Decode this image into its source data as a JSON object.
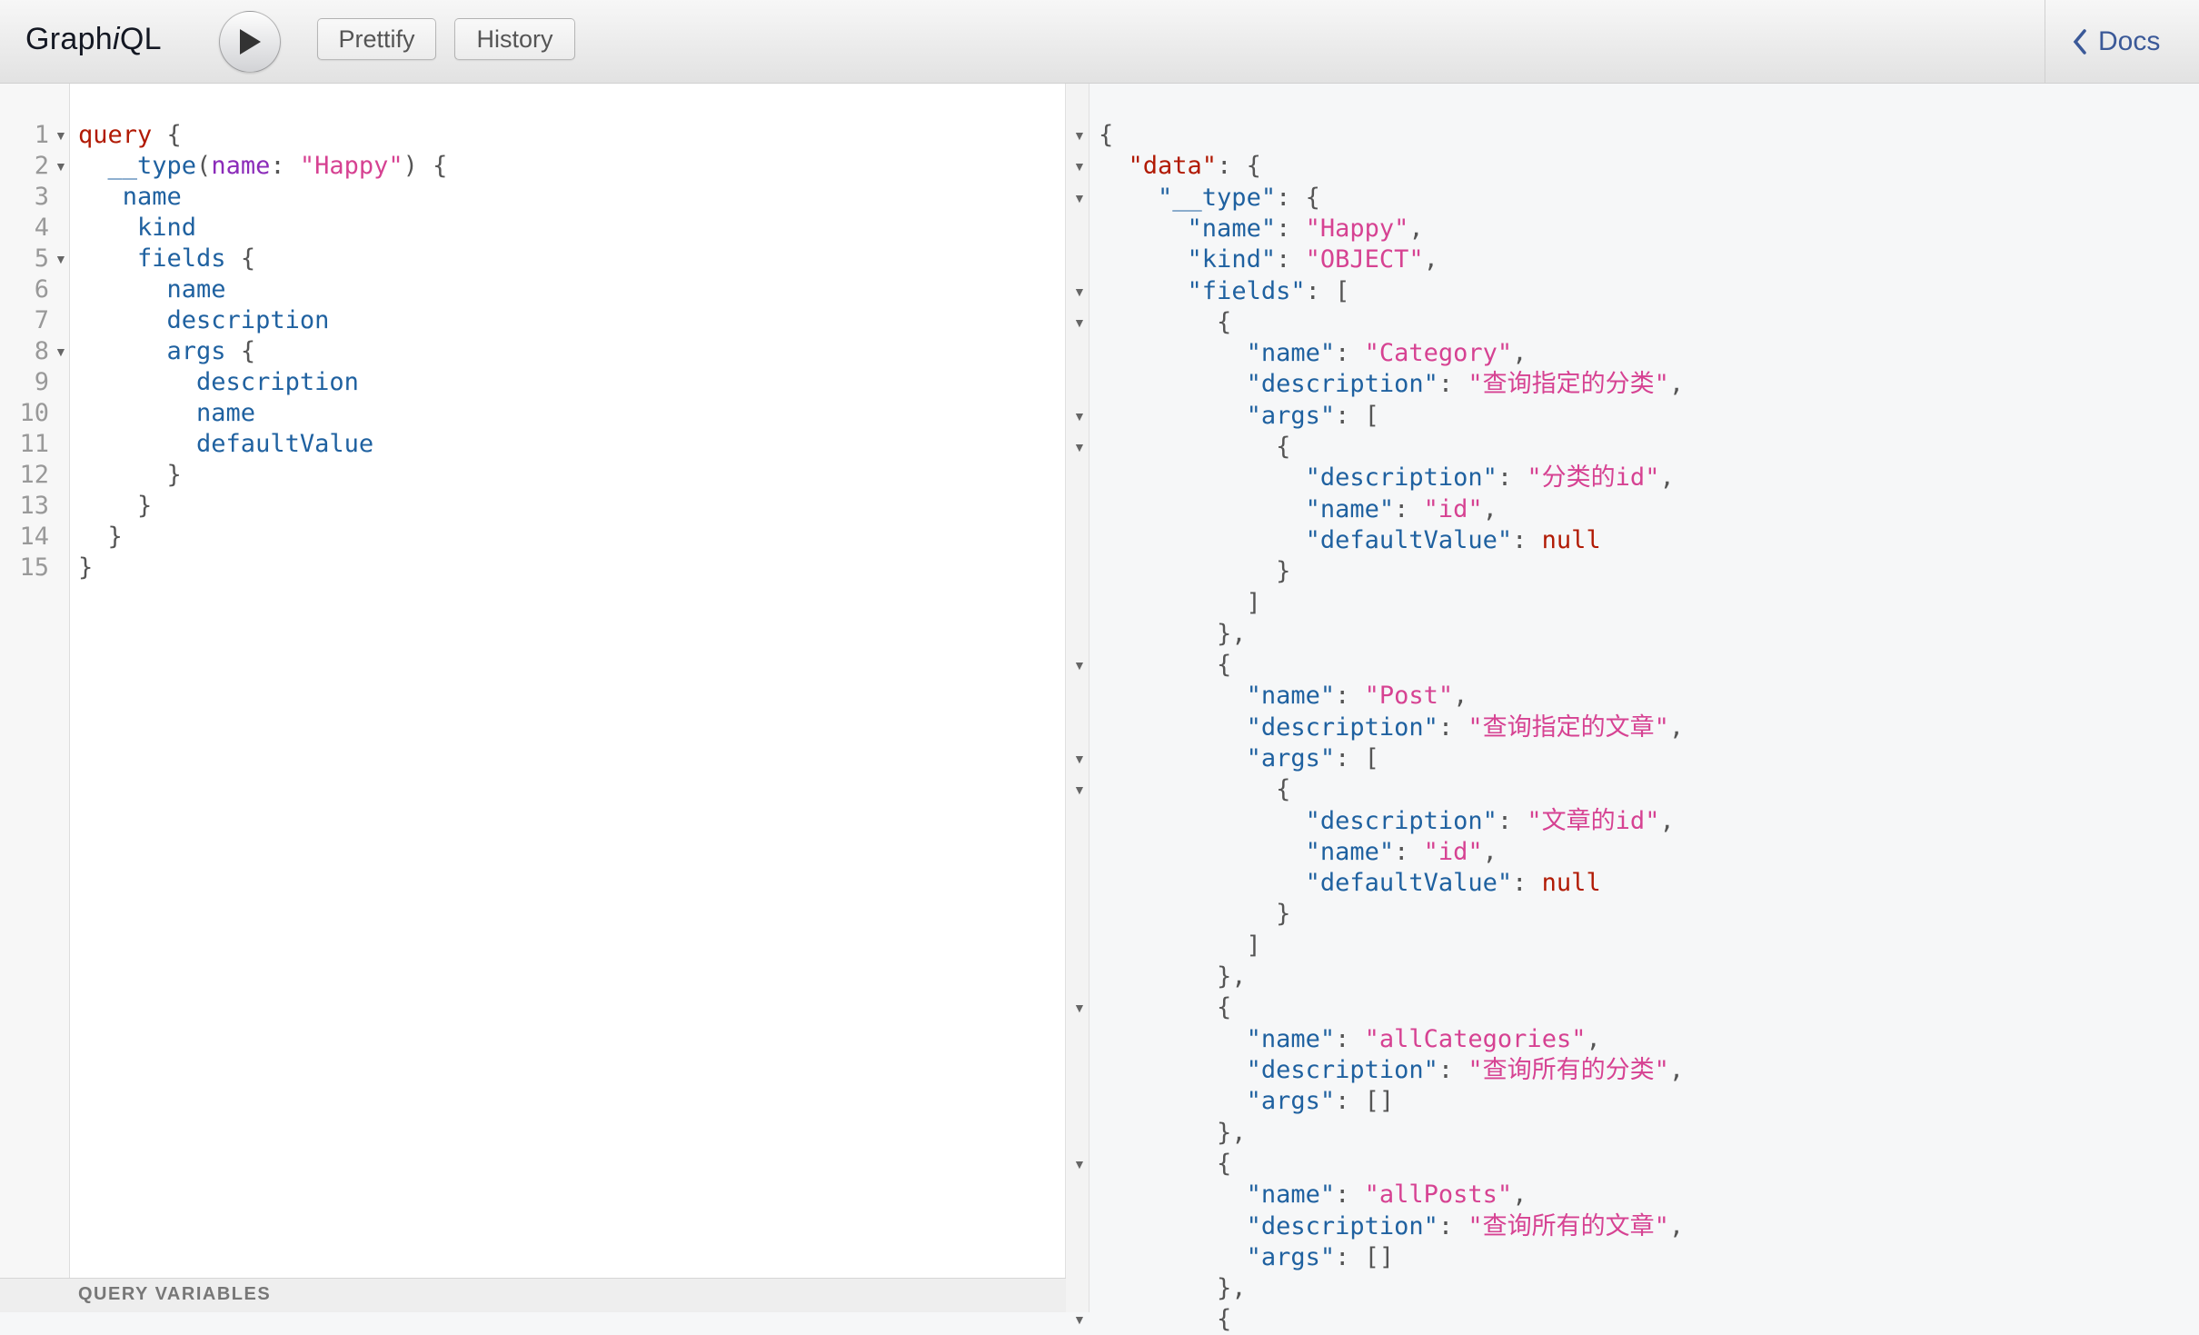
{
  "app": {
    "title_prefix": "Graph",
    "title_italic": "i",
    "title_suffix": "QL"
  },
  "toolbar": {
    "run_label": "Execute Query",
    "prettify_label": "Prettify",
    "history_label": "History",
    "docs_label": "Docs"
  },
  "icons": {
    "run": "play-icon",
    "docs": "chevron-left-icon"
  },
  "editor": {
    "line_numbers": [
      "1",
      "2",
      "3",
      "4",
      "5",
      "6",
      "7",
      "8",
      "9",
      "10",
      "11",
      "12",
      "13",
      "14",
      "15"
    ],
    "lines": [
      {
        "tokens": [
          {
            "t": "query",
            "c": "kw"
          },
          {
            "t": " {",
            "c": "pn"
          }
        ]
      },
      {
        "tokens": [
          {
            "t": "  __type",
            "c": "fd"
          },
          {
            "t": "(",
            "c": "pn"
          },
          {
            "t": "name",
            "c": "at"
          },
          {
            "t": ": ",
            "c": "pn"
          },
          {
            "t": "\"Happy\"",
            "c": "st"
          },
          {
            "t": ") {",
            "c": "pn"
          }
        ]
      },
      {
        "tokens": [
          {
            "t": "   name",
            "c": "fd"
          }
        ]
      },
      {
        "tokens": [
          {
            "t": "    kind",
            "c": "fd"
          }
        ]
      },
      {
        "tokens": [
          {
            "t": "    fields",
            "c": "fd"
          },
          {
            "t": " {",
            "c": "pn"
          }
        ]
      },
      {
        "tokens": [
          {
            "t": "      name",
            "c": "fd"
          }
        ]
      },
      {
        "tokens": [
          {
            "t": "      description",
            "c": "fd"
          }
        ]
      },
      {
        "tokens": [
          {
            "t": "      args",
            "c": "fd"
          },
          {
            "t": " {",
            "c": "pn"
          }
        ]
      },
      {
        "tokens": [
          {
            "t": "        description",
            "c": "fd"
          }
        ]
      },
      {
        "tokens": [
          {
            "t": "        name",
            "c": "fd"
          }
        ]
      },
      {
        "tokens": [
          {
            "t": "        defaultValue",
            "c": "fd"
          }
        ]
      },
      {
        "tokens": [
          {
            "t": "      }",
            "c": "pn"
          }
        ]
      },
      {
        "tokens": [
          {
            "t": "    }",
            "c": "pn"
          }
        ]
      },
      {
        "tokens": [
          {
            "t": "  }",
            "c": "pn"
          }
        ]
      },
      {
        "tokens": [
          {
            "t": "}",
            "c": "pn"
          }
        ]
      }
    ],
    "fold_lines": [
      1,
      2,
      5,
      8
    ],
    "query_variables_label": "QUERY VARIABLES"
  },
  "result": {
    "lines": [
      {
        "tokens": [
          {
            "t": "{",
            "c": "pn"
          }
        ],
        "fold": true
      },
      {
        "tokens": [
          {
            "t": "  ",
            "c": "pn"
          },
          {
            "t": "\"data\"",
            "c": "key first"
          },
          {
            "t": ": {",
            "c": "pn"
          }
        ],
        "fold": true
      },
      {
        "tokens": [
          {
            "t": "    ",
            "c": "pn"
          },
          {
            "t": "\"__type\"",
            "c": "key"
          },
          {
            "t": ": {",
            "c": "pn"
          }
        ],
        "fold": true
      },
      {
        "tokens": [
          {
            "t": "      ",
            "c": "pn"
          },
          {
            "t": "\"name\"",
            "c": "key"
          },
          {
            "t": ": ",
            "c": "pn"
          },
          {
            "t": "\"Happy\"",
            "c": "sv"
          },
          {
            "t": ",",
            "c": "pn"
          }
        ]
      },
      {
        "tokens": [
          {
            "t": "      ",
            "c": "pn"
          },
          {
            "t": "\"kind\"",
            "c": "key"
          },
          {
            "t": ": ",
            "c": "pn"
          },
          {
            "t": "\"OBJECT\"",
            "c": "sv"
          },
          {
            "t": ",",
            "c": "pn"
          }
        ]
      },
      {
        "tokens": [
          {
            "t": "      ",
            "c": "pn"
          },
          {
            "t": "\"fields\"",
            "c": "key"
          },
          {
            "t": ": [",
            "c": "pn"
          }
        ],
        "fold": true
      },
      {
        "tokens": [
          {
            "t": "        {",
            "c": "pn"
          }
        ],
        "fold": true
      },
      {
        "tokens": [
          {
            "t": "          ",
            "c": "pn"
          },
          {
            "t": "\"name\"",
            "c": "key"
          },
          {
            "t": ": ",
            "c": "pn"
          },
          {
            "t": "\"Category\"",
            "c": "sv"
          },
          {
            "t": ",",
            "c": "pn"
          }
        ]
      },
      {
        "tokens": [
          {
            "t": "          ",
            "c": "pn"
          },
          {
            "t": "\"description\"",
            "c": "key"
          },
          {
            "t": ": ",
            "c": "pn"
          },
          {
            "t": "\"查询指定的分类\"",
            "c": "sv"
          },
          {
            "t": ",",
            "c": "pn"
          }
        ]
      },
      {
        "tokens": [
          {
            "t": "          ",
            "c": "pn"
          },
          {
            "t": "\"args\"",
            "c": "key"
          },
          {
            "t": ": [",
            "c": "pn"
          }
        ],
        "fold": true
      },
      {
        "tokens": [
          {
            "t": "            {",
            "c": "pn"
          }
        ],
        "fold": true
      },
      {
        "tokens": [
          {
            "t": "              ",
            "c": "pn"
          },
          {
            "t": "\"description\"",
            "c": "key"
          },
          {
            "t": ": ",
            "c": "pn"
          },
          {
            "t": "\"分类的id\"",
            "c": "sv"
          },
          {
            "t": ",",
            "c": "pn"
          }
        ]
      },
      {
        "tokens": [
          {
            "t": "              ",
            "c": "pn"
          },
          {
            "t": "\"name\"",
            "c": "key"
          },
          {
            "t": ": ",
            "c": "pn"
          },
          {
            "t": "\"id\"",
            "c": "sv"
          },
          {
            "t": ",",
            "c": "pn"
          }
        ]
      },
      {
        "tokens": [
          {
            "t": "              ",
            "c": "pn"
          },
          {
            "t": "\"defaultValue\"",
            "c": "key"
          },
          {
            "t": ": ",
            "c": "pn"
          },
          {
            "t": "null",
            "c": "nul"
          }
        ]
      },
      {
        "tokens": [
          {
            "t": "            }",
            "c": "pn"
          }
        ]
      },
      {
        "tokens": [
          {
            "t": "          ]",
            "c": "pn"
          }
        ]
      },
      {
        "tokens": [
          {
            "t": "        },",
            "c": "pn"
          }
        ]
      },
      {
        "tokens": [
          {
            "t": "        {",
            "c": "pn"
          }
        ],
        "fold": true
      },
      {
        "tokens": [
          {
            "t": "          ",
            "c": "pn"
          },
          {
            "t": "\"name\"",
            "c": "key"
          },
          {
            "t": ": ",
            "c": "pn"
          },
          {
            "t": "\"Post\"",
            "c": "sv"
          },
          {
            "t": ",",
            "c": "pn"
          }
        ]
      },
      {
        "tokens": [
          {
            "t": "          ",
            "c": "pn"
          },
          {
            "t": "\"description\"",
            "c": "key"
          },
          {
            "t": ": ",
            "c": "pn"
          },
          {
            "t": "\"查询指定的文章\"",
            "c": "sv"
          },
          {
            "t": ",",
            "c": "pn"
          }
        ]
      },
      {
        "tokens": [
          {
            "t": "          ",
            "c": "pn"
          },
          {
            "t": "\"args\"",
            "c": "key"
          },
          {
            "t": ": [",
            "c": "pn"
          }
        ],
        "fold": true
      },
      {
        "tokens": [
          {
            "t": "            {",
            "c": "pn"
          }
        ],
        "fold": true
      },
      {
        "tokens": [
          {
            "t": "              ",
            "c": "pn"
          },
          {
            "t": "\"description\"",
            "c": "key"
          },
          {
            "t": ": ",
            "c": "pn"
          },
          {
            "t": "\"文章的id\"",
            "c": "sv"
          },
          {
            "t": ",",
            "c": "pn"
          }
        ]
      },
      {
        "tokens": [
          {
            "t": "              ",
            "c": "pn"
          },
          {
            "t": "\"name\"",
            "c": "key"
          },
          {
            "t": ": ",
            "c": "pn"
          },
          {
            "t": "\"id\"",
            "c": "sv"
          },
          {
            "t": ",",
            "c": "pn"
          }
        ]
      },
      {
        "tokens": [
          {
            "t": "              ",
            "c": "pn"
          },
          {
            "t": "\"defaultValue\"",
            "c": "key"
          },
          {
            "t": ": ",
            "c": "pn"
          },
          {
            "t": "null",
            "c": "nul"
          }
        ]
      },
      {
        "tokens": [
          {
            "t": "            }",
            "c": "pn"
          }
        ]
      },
      {
        "tokens": [
          {
            "t": "          ]",
            "c": "pn"
          }
        ]
      },
      {
        "tokens": [
          {
            "t": "        },",
            "c": "pn"
          }
        ]
      },
      {
        "tokens": [
          {
            "t": "        {",
            "c": "pn"
          }
        ],
        "fold": true
      },
      {
        "tokens": [
          {
            "t": "          ",
            "c": "pn"
          },
          {
            "t": "\"name\"",
            "c": "key"
          },
          {
            "t": ": ",
            "c": "pn"
          },
          {
            "t": "\"allCategories\"",
            "c": "sv"
          },
          {
            "t": ",",
            "c": "pn"
          }
        ]
      },
      {
        "tokens": [
          {
            "t": "          ",
            "c": "pn"
          },
          {
            "t": "\"description\"",
            "c": "key"
          },
          {
            "t": ": ",
            "c": "pn"
          },
          {
            "t": "\"查询所有的分类\"",
            "c": "sv"
          },
          {
            "t": ",",
            "c": "pn"
          }
        ]
      },
      {
        "tokens": [
          {
            "t": "          ",
            "c": "pn"
          },
          {
            "t": "\"args\"",
            "c": "key"
          },
          {
            "t": ": []",
            "c": "pn"
          }
        ]
      },
      {
        "tokens": [
          {
            "t": "        },",
            "c": "pn"
          }
        ]
      },
      {
        "tokens": [
          {
            "t": "        {",
            "c": "pn"
          }
        ],
        "fold": true
      },
      {
        "tokens": [
          {
            "t": "          ",
            "c": "pn"
          },
          {
            "t": "\"name\"",
            "c": "key"
          },
          {
            "t": ": ",
            "c": "pn"
          },
          {
            "t": "\"allPosts\"",
            "c": "sv"
          },
          {
            "t": ",",
            "c": "pn"
          }
        ]
      },
      {
        "tokens": [
          {
            "t": "          ",
            "c": "pn"
          },
          {
            "t": "\"description\"",
            "c": "key"
          },
          {
            "t": ": ",
            "c": "pn"
          },
          {
            "t": "\"查询所有的文章\"",
            "c": "sv"
          },
          {
            "t": ",",
            "c": "pn"
          }
        ]
      },
      {
        "tokens": [
          {
            "t": "          ",
            "c": "pn"
          },
          {
            "t": "\"args\"",
            "c": "key"
          },
          {
            "t": ": []",
            "c": "pn"
          }
        ]
      },
      {
        "tokens": [
          {
            "t": "        },",
            "c": "pn"
          }
        ]
      },
      {
        "tokens": [
          {
            "t": "        {",
            "c": "pn"
          }
        ],
        "fold": true
      }
    ]
  },
  "colors": {
    "keyword": "#b11a04",
    "field": "#1f61a0",
    "argument": "#8b2bb9",
    "string": "#d64292",
    "docs_link": "#3b5998"
  }
}
